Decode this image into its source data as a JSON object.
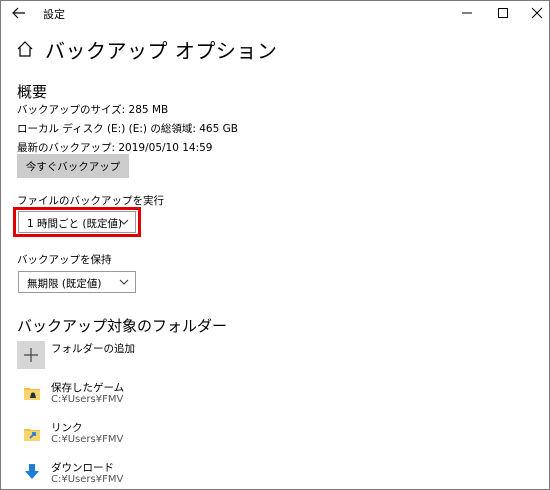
{
  "window": {
    "title": "設定"
  },
  "page": {
    "title": "バックアップ オプション"
  },
  "overview": {
    "heading": "概要",
    "size": "バックアップのサイズ: 285 MB",
    "disk": "ローカル ディスク (E:) (E:) の総領域: 465 GB",
    "latest": "最新のバックアップ: 2019/05/10 14:59",
    "backup_now": "今すぐバックアップ"
  },
  "run_backup": {
    "label": "ファイルのバックアップを実行",
    "value": "1 時間ごと (既定値)"
  },
  "keep_backup": {
    "label": "バックアップを保持",
    "value": "無期限 (既定値)"
  },
  "folders": {
    "heading": "バックアップ対象のフォルダー",
    "add_label": "フォルダーの追加",
    "items": [
      {
        "name": "保存したゲーム",
        "path": "C:¥Users¥FMV",
        "icon": "saved-games-folder-icon"
      },
      {
        "name": "リンク",
        "path": "C:¥Users¥FMV",
        "icon": "links-folder-icon"
      },
      {
        "name": "ダウンロード",
        "path": "C:¥Users¥FMV",
        "icon": "download-arrow-icon"
      }
    ]
  },
  "colors": {
    "highlight": "#e00000",
    "button_bg": "#cccccc",
    "accent_blue": "#1e7fd8"
  }
}
